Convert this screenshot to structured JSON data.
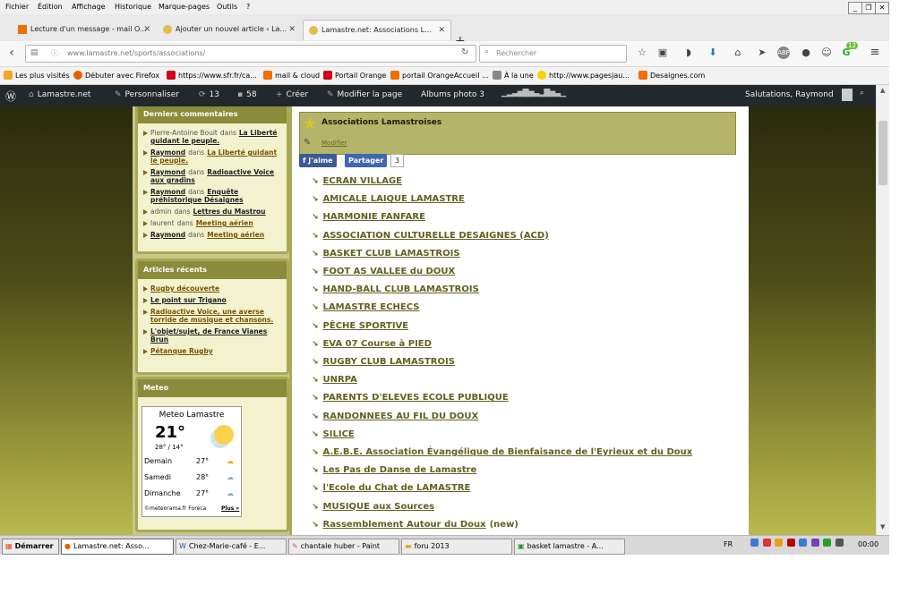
{
  "menu": [
    "Fichier",
    "Édition",
    "Affichage",
    "Historique",
    "Marque-pages",
    "Outils",
    "?"
  ],
  "tabs": [
    {
      "title": "Lecture d'un message - mail O..."
    },
    {
      "title": "Ajouter un nouvel article ‹ La..."
    },
    {
      "title": "Lamastre.net: Associations L..."
    }
  ],
  "nav": {
    "url": "www.lamastre.net/sports/associations/",
    "search_placeholder": "Rechercher",
    "badge": "12"
  },
  "bookmarks": [
    "Les plus visités",
    "Débuter avec Firefox",
    "https://www.sfr.fr/ca...",
    "mail & cloud",
    "Portail Orange",
    "portail OrangeAccueil ...",
    "À la une",
    "http://www.pagesjau...",
    "Desaignes.com"
  ],
  "adminbar": {
    "site": "Lamastre.net",
    "customize": "Personnaliser",
    "updates": "13",
    "comments": "58",
    "new": "Créer",
    "edit": "Modifier la page",
    "albums": "Albums photo 3",
    "greeting": "Salutations, Raymond"
  },
  "comments_widget": {
    "title": "Derniers commentaires",
    "items": [
      {
        "author": "Pierre-Antoine Bouit",
        "sep": "dans",
        "link": "La Liberté guidant le peuple."
      },
      {
        "author": "Raymond",
        "sep": "dans",
        "link": "La Liberté guidant le peuple."
      },
      {
        "author": "Raymond",
        "sep": "dans",
        "link": "Radioactive Voice aux gradins"
      },
      {
        "author": "Raymond",
        "sep": "dans",
        "link": "Enquête préhistorique Désaignes"
      },
      {
        "author": "admin",
        "sep": "dans",
        "link": "Lettres du Mastrou"
      },
      {
        "author": "laurent",
        "sep": "dans",
        "link": "Meeting aérien"
      },
      {
        "author": "Raymond",
        "sep": "dans",
        "link": "Meeting aérien"
      }
    ]
  },
  "recent_widget": {
    "title": "Articles récents",
    "items": [
      "Rugby découverte",
      "Le point sur Trigano",
      "Radioactive Voice, une averse torride de musique et chansons.",
      "L'objet/sujet, de France Vianes Brun",
      "Pétanque Rugby"
    ]
  },
  "meteo": {
    "title": "Meteo",
    "city_label": "Meteo Lamastre",
    "temp": "21°",
    "minmax": "28° / 14°",
    "days": [
      {
        "day": "Demain",
        "temp": "27°"
      },
      {
        "day": "Samedi",
        "temp": "28°"
      },
      {
        "day": "Dimanche",
        "temp": "27°"
      }
    ],
    "credit": "©meteorama.fr Foreca",
    "more": "Plus »"
  },
  "post": {
    "title": "Associations Lamastroises",
    "edit": "Modifier",
    "like": "J'aime",
    "share": "Partager",
    "count": "3",
    "associations": [
      "ECRAN VILLAGE",
      "AMICALE LAIQUE LAMASTRE",
      "HARMONIE FANFARE",
      "ASSOCIATION CULTURELLE DESAIGNES (ACD)",
      "BASKET CLUB LAMASTROIS",
      "FOOT AS VALLEE du DOUX",
      "HAND-BALL CLUB LAMASTROIS",
      "LAMASTRE ECHECS",
      "PÊCHE SPORTIVE",
      "EVA 07 Course à PIED",
      "RUGBY CLUB LAMASTROIS",
      "UNRPA",
      "PARENTS D'ELEVES ECOLE PUBLIQUE",
      "RANDONNEES AU FIL DU DOUX",
      "SILICE",
      "A.E.B.E. Association Évangélique de Bienfaisance de l'Eyrieux et du Doux",
      "Les Pas de Danse de Lamastre",
      "l'Ecole du Chat de LAMASTRE",
      "MUSIQUE aux Sources",
      "Rassemblement Autour du Doux"
    ],
    "new_tag": "(new)"
  },
  "taskbar": {
    "start": "Démarrer",
    "items": [
      "Lamastre.net: Asso...",
      "Chez-Marie-café - E...",
      "chantale huber - Paint",
      "foru 2013",
      "basket lamastre - A..."
    ],
    "lang": "FR",
    "clock": "00:00"
  }
}
